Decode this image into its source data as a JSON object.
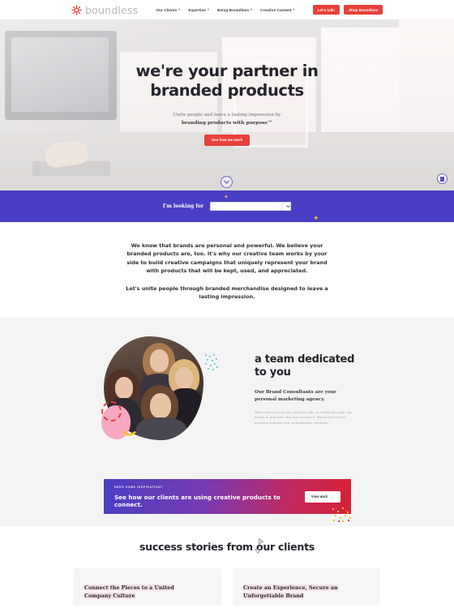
{
  "header": {
    "logo_text": "boundless",
    "nav": [
      {
        "label": "Our Clients",
        "caret": "▾"
      },
      {
        "label": "Expertise",
        "caret": "▾"
      },
      {
        "label": "Being Boundless",
        "caret": "▾"
      },
      {
        "label": "Creative Content",
        "caret": "▾"
      }
    ],
    "buttons": [
      {
        "label": "Let's talk!"
      },
      {
        "label": "Shop Boundless"
      }
    ],
    "accent_color": "#e8403a",
    "logo_color": "#e8403a"
  },
  "hero": {
    "heading_line1": "we're your partner in",
    "heading_line2": "branded products",
    "sub_line1": "Unite people and leave a lasting impression by",
    "sub_line2": "branding products with purpose™",
    "cta_label": "See how we work",
    "scroll_hint": "scroll-down"
  },
  "search_bar": {
    "label": "I'm looking for",
    "select_value": "",
    "select_placeholder": "...",
    "background_color": "#4a3fc4"
  },
  "intro": {
    "paragraph1": "We know that brands are personal and powerful. We believe your branded products are, too. It's why our creative team works by your side to build creative campaigns that uniquely represent your brand with products that will be kept, used, and appreciated.",
    "paragraph2": "Let's unite people through branded merchandise designed to leave a lasting impression."
  },
  "team": {
    "heading": "a team dedicated to you",
    "lead": "Our Brand Consultants are your personal marketing agency.",
    "body": "We're here to bring your brand to life, no matter the goal. You dream it, and we'll help you achieve it. We're here to turn branded products into unforgettable moments.",
    "photo_alt": "team-photo"
  },
  "banner": {
    "kicker": "NEED SOME INSPIRATION?",
    "headline": "See how our clients are using creative products to connect.",
    "button_label": "View work",
    "button_arrow": "→",
    "gradient_start": "#4a3fc4",
    "gradient_end": "#d62234"
  },
  "stories": {
    "heading": "success stories from our clients",
    "cards": [
      {
        "title_line1": "Connect the Pieces to a United",
        "title_line2": "Company Culture"
      },
      {
        "title_line1": "Create an Experience, Secure an",
        "title_line2": "Unforgettable Brand"
      }
    ]
  }
}
